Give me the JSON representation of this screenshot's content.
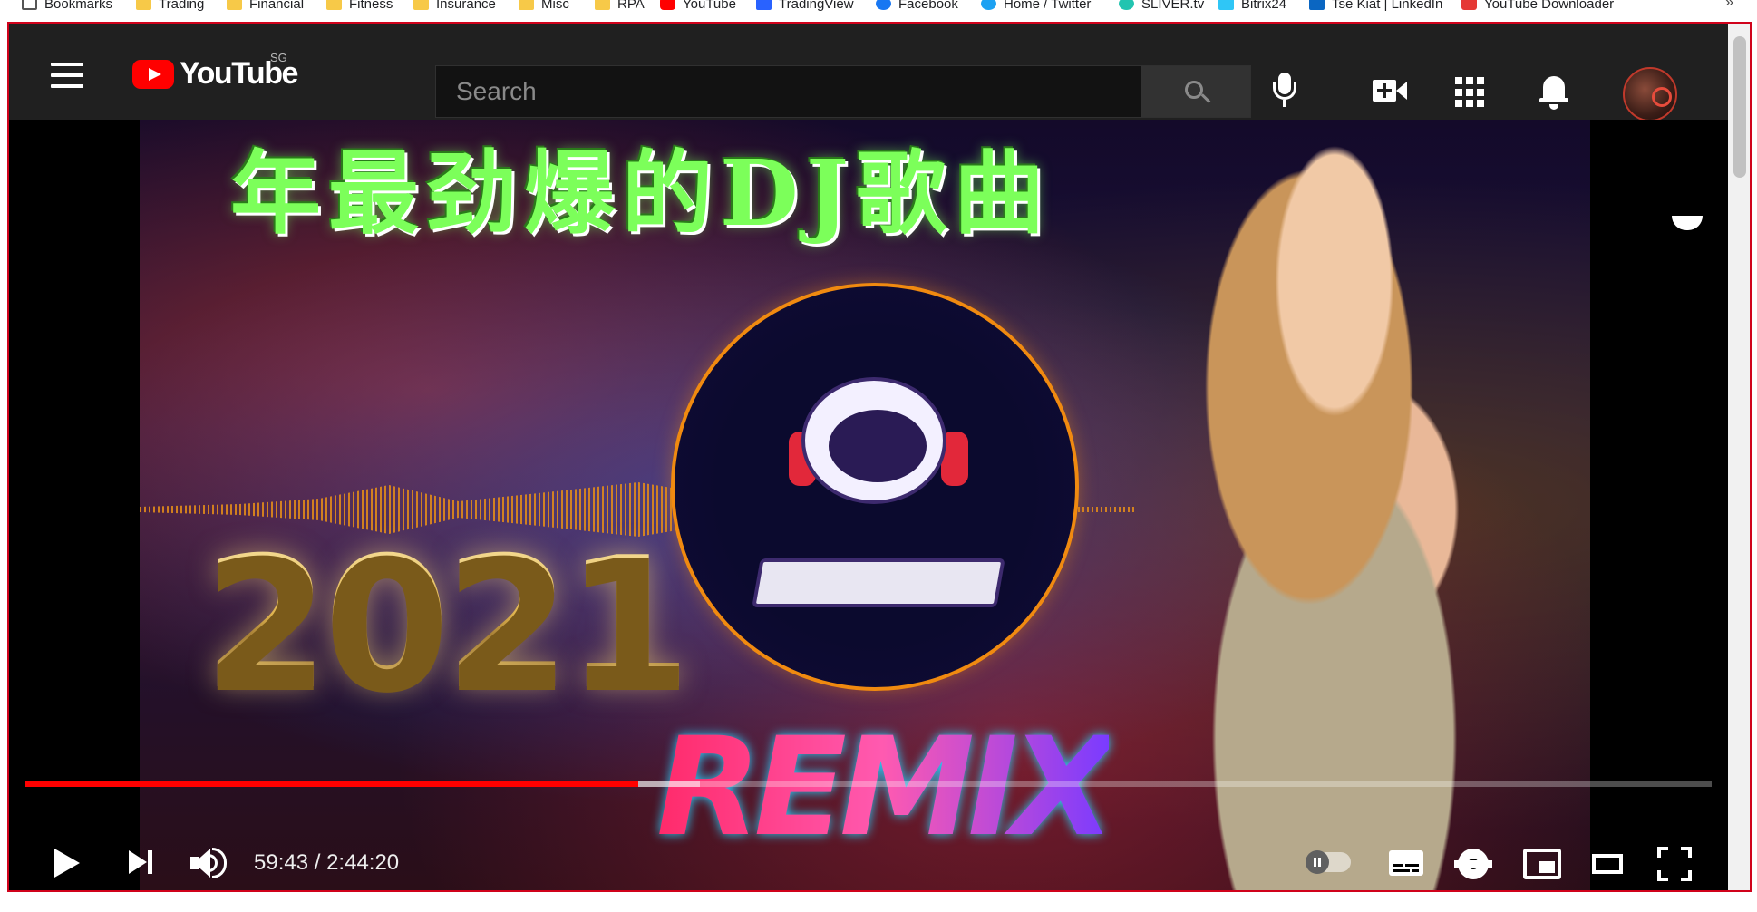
{
  "bookmarks_bar": {
    "items": [
      {
        "label": "Bookmarks",
        "icon": "bookmarks-icon"
      },
      {
        "label": "Trading",
        "icon": "folder-icon"
      },
      {
        "label": "Financial",
        "icon": "folder-icon"
      },
      {
        "label": "Fitness",
        "icon": "folder-icon"
      },
      {
        "label": "Insurance",
        "icon": "folder-icon"
      },
      {
        "label": "Misc",
        "icon": "folder-icon"
      },
      {
        "label": "RPA",
        "icon": "folder-icon"
      },
      {
        "label": "YouTube",
        "icon": "youtube-icon"
      },
      {
        "label": "TradingView",
        "icon": "tradingview-icon"
      },
      {
        "label": "Facebook",
        "icon": "facebook-icon"
      },
      {
        "label": "Home / Twitter",
        "icon": "twitter-icon"
      },
      {
        "label": "SLIVER.tv",
        "icon": "sliver-icon"
      },
      {
        "label": "Bitrix24",
        "icon": "bitrix-icon"
      },
      {
        "label": "Tse Kiat | LinkedIn",
        "icon": "linkedin-icon"
      },
      {
        "label": "YouTube Downloader",
        "icon": "download-icon"
      }
    ],
    "more": "»"
  },
  "header": {
    "logo_text": "YouTube",
    "region": "SG",
    "search_placeholder": "Search"
  },
  "video": {
    "thumbnail_title": "年最劲爆的DJ歌曲",
    "thumbnail_year": "2021",
    "thumbnail_remix": "REMIX"
  },
  "player": {
    "current_time": "59:43",
    "separator": " / ",
    "duration": "2:44:20",
    "progress_fraction": 0.3636,
    "buffered_fraction": 0.4,
    "autoplay": false
  },
  "colors": {
    "header_bg": "#202020",
    "brand_red": "#ff0000",
    "frame_border": "#d0021b"
  }
}
